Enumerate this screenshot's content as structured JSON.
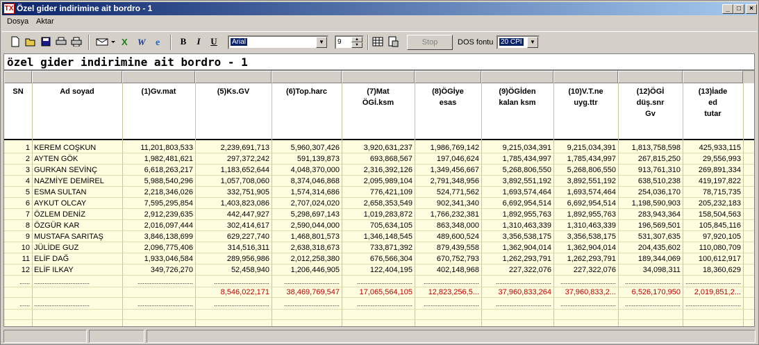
{
  "window": {
    "title": "Özel gider indirimine ait bordro - 1",
    "app_icon": "TX"
  },
  "window_buttons": {
    "minimize": "_",
    "restore": "□",
    "close": "×"
  },
  "menu": [
    {
      "label": "Dosya"
    },
    {
      "label": "Aktar"
    }
  ],
  "toolbar": {
    "font_name": "Arial",
    "font_size": "9",
    "stop_label": "Stop",
    "dos_font_label": "DOS fontu",
    "dos_font_value": "20 CPI",
    "bold": "B",
    "italic": "I",
    "underline": "U"
  },
  "report_title": "özel gider indirimine ait bordro - 1",
  "columns": [
    "SN",
    "Ad soyad",
    "(1)Gv.mat",
    "(5)Ks.GV",
    "(6)Top.harc",
    "(7)Mat\nÖGİ.ksm",
    "(8)ÖGİye\nesas",
    "(9)ÖGİden\nkalan ksm",
    "(10)V.T.ne\nuyg.ttr",
    "(12)ÖGİ\ndüş.snr\nGv",
    "(13)İade\ned\ntutar"
  ],
  "rows": [
    [
      "1",
      "KEREM COŞKUN",
      "11,201,803,533",
      "2,239,691,713",
      "5,960,307,426",
      "3,920,631,237",
      "1,986,769,142",
      "9,215,034,391",
      "9,215,034,391",
      "1,813,758,598",
      "425,933,115"
    ],
    [
      "2",
      "AYTEN GÖK",
      "1,982,481,621",
      "297,372,242",
      "591,139,873",
      "693,868,567",
      "197,046,624",
      "1,785,434,997",
      "1,785,434,997",
      "267,815,250",
      "29,556,993"
    ],
    [
      "3",
      "GURKAN SEVİNÇ",
      "6,618,263,217",
      "1,183,652,644",
      "4,048,370,000",
      "2,316,392,126",
      "1,349,456,667",
      "5,268,806,550",
      "5,268,806,550",
      "913,761,310",
      "269,891,334"
    ],
    [
      "4",
      "NAZMİYE DEMİREL",
      "5,988,540,296",
      "1,057,708,060",
      "8,374,046,868",
      "2,095,989,104",
      "2,791,348,956",
      "3,892,551,192",
      "3,892,551,192",
      "638,510,238",
      "419,197,822"
    ],
    [
      "5",
      "ESMA SULTAN",
      "2,218,346,026",
      "332,751,905",
      "1,574,314,686",
      "776,421,109",
      "524,771,562",
      "1,693,574,464",
      "1,693,574,464",
      "254,036,170",
      "78,715,735"
    ],
    [
      "6",
      "AYKUT OLCAY",
      "7,595,295,854",
      "1,403,823,086",
      "2,707,024,020",
      "2,658,353,549",
      "902,341,340",
      "6,692,954,514",
      "6,692,954,514",
      "1,198,590,903",
      "205,232,183"
    ],
    [
      "7",
      "ÖZLEM DENİZ",
      "2,912,239,635",
      "442,447,927",
      "5,298,697,143",
      "1,019,283,872",
      "1,766,232,381",
      "1,892,955,763",
      "1,892,955,763",
      "283,943,364",
      "158,504,563"
    ],
    [
      "8",
      "ÖZGÜR KAR",
      "2,016,097,444",
      "302,414,617",
      "2,590,044,000",
      "705,634,105",
      "863,348,000",
      "1,310,463,339",
      "1,310,463,339",
      "196,569,501",
      "105,845,116"
    ],
    [
      "9",
      "MUSTAFA SARITAŞ",
      "3,846,138,699",
      "629,227,740",
      "1,468,801,573",
      "1,346,148,545",
      "489,600,524",
      "3,356,538,175",
      "3,356,538,175",
      "531,307,635",
      "97,920,105"
    ],
    [
      "10",
      "JÜLİDE GUZ",
      "2,096,775,406",
      "314,516,311",
      "2,638,318,673",
      "733,871,392",
      "879,439,558",
      "1,362,904,014",
      "1,362,904,014",
      "204,435,602",
      "110,080,709"
    ],
    [
      "11",
      "ELİF DAĞ",
      "1,933,046,584",
      "289,956,986",
      "2,012,258,380",
      "676,566,304",
      "670,752,793",
      "1,262,293,791",
      "1,262,293,791",
      "189,344,069",
      "100,612,917"
    ],
    [
      "12",
      "ELİF ILKAY",
      "349,726,270",
      "52,458,940",
      "1,206,446,905",
      "122,404,195",
      "402,148,968",
      "227,322,076",
      "227,322,076",
      "34,098,311",
      "18,360,629"
    ]
  ],
  "dots_row": [
    "......",
    "................................",
    "................................",
    "................................",
    "................................",
    "................................",
    "................................",
    "................................",
    "................................",
    "................................",
    "................................"
  ],
  "totals": [
    "",
    "",
    "",
    "8,546,022,171",
    "38,469,769,547",
    "17,065,564,105",
    "12,823,256,5...",
    "37,960,833,264",
    "37,960,833,2...",
    "6,526,170,950",
    "2,019,851,2..."
  ]
}
